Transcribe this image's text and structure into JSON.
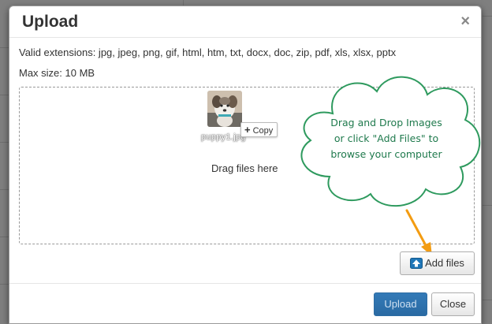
{
  "modal": {
    "title": "Upload",
    "close_symbol": "×",
    "valid_extensions": "Valid extensions: jpg, jpeg, png, gif, html, htm, txt, docx, doc, zip, pdf, xls, xlsx, pptx",
    "max_size": "Max size: 10 MB"
  },
  "dropzone": {
    "file_name": "puppy1.jpg",
    "copy_label": "Copy",
    "copy_plus": "+",
    "drag_text": "Drag files here"
  },
  "callout": {
    "line1": "Drag and Drop Images",
    "line2": "or click \"Add Files\" to",
    "line3": "browse your computer",
    "text_color": "#1f7a4d",
    "border_color": "#2e9a5e"
  },
  "buttons": {
    "add_files": "Add files",
    "upload": "Upload",
    "close": "Close"
  },
  "colors": {
    "primary": "#337ab7",
    "arrow": "#f39c12"
  },
  "icons": {
    "close": "close-icon",
    "upload": "upload-icon",
    "arrow": "arrow-down-right-icon"
  }
}
